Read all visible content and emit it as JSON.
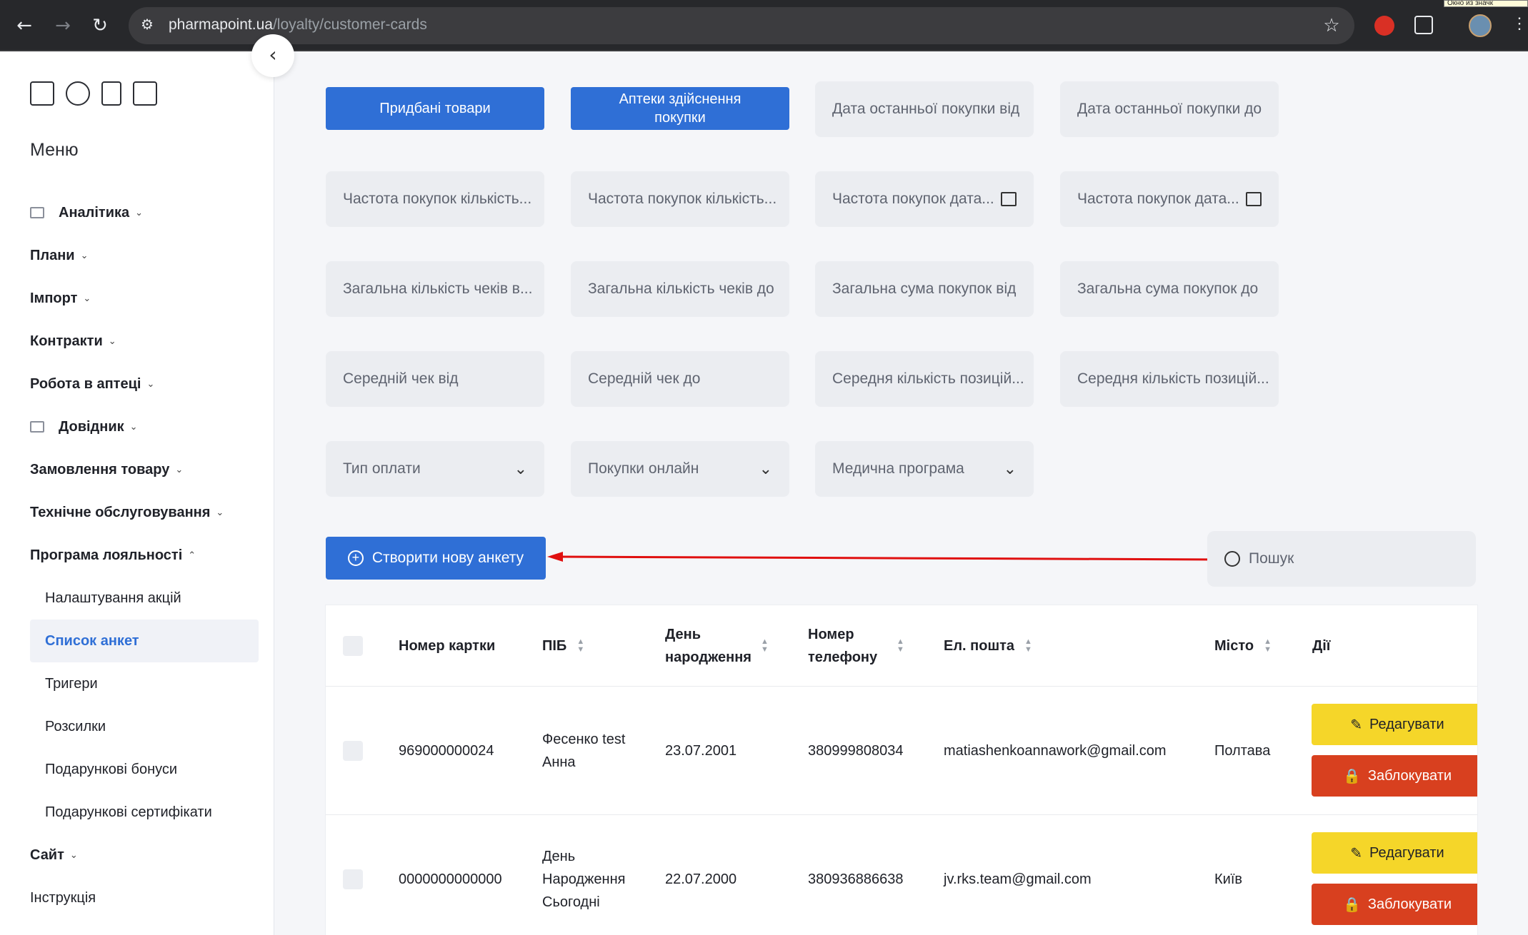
{
  "browser": {
    "url_host": "pharmapoint.ua",
    "url_path": "/loyalty/customer-cards",
    "back_icon": "←",
    "forward_icon": "→",
    "reload_icon": "↻",
    "star_icon": "☆",
    "tooltip": "Окно из значк"
  },
  "sidebar": {
    "menu_title": "Меню",
    "collapse_icon": "‹",
    "items": [
      {
        "label": "Аналітика",
        "chev": "⌄"
      },
      {
        "label": "Плани",
        "chev": "⌄"
      },
      {
        "label": "Імпорт",
        "chev": "⌄"
      },
      {
        "label": "Контракти",
        "chev": "⌄"
      },
      {
        "label": "Робота в аптеці",
        "chev": "⌄"
      },
      {
        "label": "Довідник",
        "chev": "⌄"
      },
      {
        "label": "Замовлення товару",
        "chev": "⌄"
      },
      {
        "label": "Технічне обслуговування",
        "chev": "⌄"
      },
      {
        "label": "Програма лояльності",
        "chev": "⌃"
      },
      {
        "label": "Налаштування акцій"
      },
      {
        "label": "Список анкет"
      },
      {
        "label": "Тригери"
      },
      {
        "label": "Розсилки"
      },
      {
        "label": "Подарункові бонуси"
      },
      {
        "label": "Подарункові сертифікати"
      },
      {
        "label": "Сайт",
        "chev": "⌄"
      },
      {
        "label": "Інструкція"
      }
    ]
  },
  "filters": {
    "purchased_goods": "Придбані товари",
    "pharmacies_label": "Аптеки здійснення покупки",
    "last_purchase_from": "Дата останньої покупки від",
    "last_purchase_to": "Дата останньої покупки до",
    "freq_count_from": "Частота покупок кількість...",
    "freq_count_to": "Частота покупок кількість...",
    "freq_date_from": "Частота покупок дата...",
    "freq_date_to": "Частота покупок дата...",
    "checks_from": "Загальна кількість чеків в...",
    "checks_to": "Загальна кількість чеків до",
    "sum_from": "Загальна сума покупок від",
    "sum_to": "Загальна сума покупок до",
    "avg_check_from": "Середній чек від",
    "avg_check_to": "Середній чек до",
    "avg_items_from": "Середня кількість позицій...",
    "avg_items_to": "Середня кількість позицій...",
    "payment_type": "Тип оплати",
    "online_purchases": "Покупки онлайн",
    "medical_program": "Медична програма",
    "dropdown_icon": "⌄"
  },
  "actions": {
    "create_label": "Створити нову анкету",
    "create_icon": "+",
    "search_placeholder": "Пошук"
  },
  "table": {
    "headers": {
      "card": "Номер картки",
      "name": "ПІБ",
      "birthday": "День народження",
      "phone": "Номер телефону",
      "email": "Ел. пошта",
      "city": "Місто",
      "actions": "Дії"
    },
    "sort_up": "▲",
    "sort_down": "▼",
    "edit_label": "Редагувати",
    "edit_icon": "✎",
    "block_label": "Заблокувати",
    "block_icon": "🔒",
    "rows": [
      {
        "card": "969000000024",
        "name": "Фесенко test Анна",
        "birthday": "23.07.2001",
        "phone": "380999808034",
        "email": "matiashenkoannawork@gmail.com",
        "city": "Полтава"
      },
      {
        "card": "0000000000000",
        "name": "День Народження Сьогодні",
        "birthday": "22.07.2000",
        "phone": "380936886638",
        "email": "jv.rks.team@gmail.com",
        "city": "Київ"
      }
    ]
  },
  "colors": {
    "primary": "#2f6fd6",
    "edit": "#f5d629",
    "block": "#d8401f",
    "arrow": "#e01010"
  }
}
